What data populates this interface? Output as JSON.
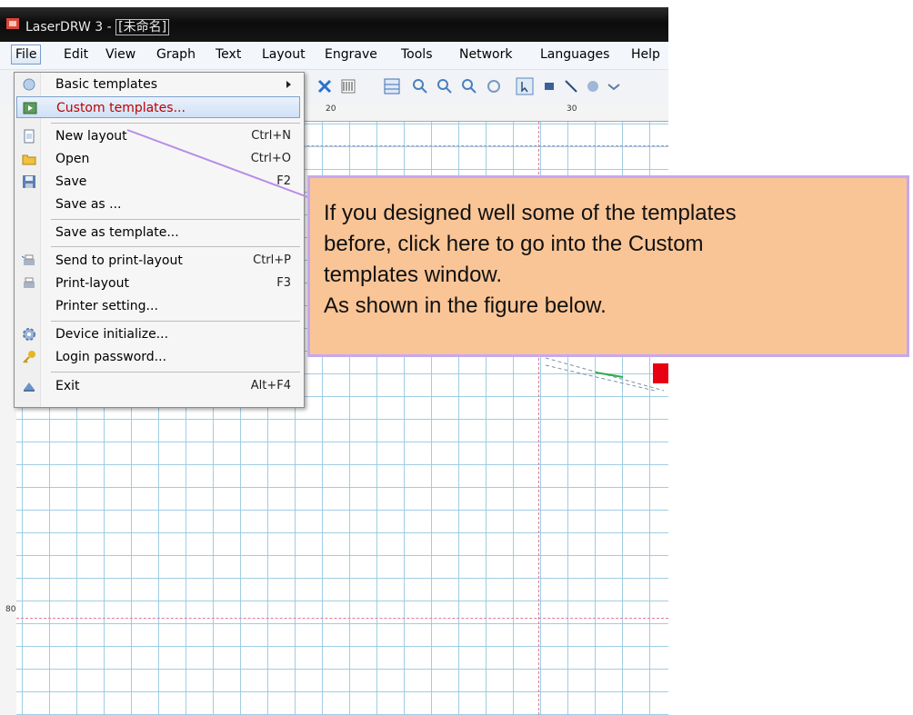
{
  "window": {
    "app_title": "LaserDRW 3 - ",
    "doc_tag": "[未命名]"
  },
  "menubar": [
    "File",
    "Edit",
    "View",
    "Graph",
    "Text",
    "Layout",
    "Engrave",
    "Tools",
    "Network",
    "Languages",
    "Help"
  ],
  "ruler": {
    "marks": [
      "20",
      "30"
    ],
    "side_mark": "80"
  },
  "file_menu": {
    "items": [
      {
        "label": "Basic templates",
        "shortcut": "",
        "icon": "templates-icon",
        "submenu": true
      },
      {
        "label": "Custom templates...",
        "shortcut": "",
        "icon": "custom-templates-icon",
        "selected": true
      },
      {
        "label": "New layout",
        "shortcut": "Ctrl+N",
        "icon": "new-layout-icon"
      },
      {
        "label": "Open",
        "shortcut": "Ctrl+O",
        "icon": "open-folder-icon"
      },
      {
        "label": "Save",
        "shortcut": "F2",
        "icon": "save-disk-icon"
      },
      {
        "label": "Save as ...",
        "shortcut": "",
        "icon": ""
      },
      {
        "label": "Save as template...",
        "shortcut": "",
        "icon": ""
      },
      {
        "label": "Send to print-layout",
        "shortcut": "Ctrl+P",
        "icon": "send-print-icon"
      },
      {
        "label": "Print-layout",
        "shortcut": "F3",
        "icon": "printer-icon"
      },
      {
        "label": "Printer setting...",
        "shortcut": "",
        "icon": ""
      },
      {
        "label": "Device initialize...",
        "shortcut": "",
        "icon": "gear-icon"
      },
      {
        "label": "Login password...",
        "shortcut": "",
        "icon": "key-icon"
      },
      {
        "label": "Exit",
        "shortcut": "Alt+F4",
        "icon": "exit-icon"
      }
    ]
  },
  "callout": {
    "line1": "If you designed well some of the templates",
    "line2": "before, click here to go into the Custom",
    "line3": "templates window.",
    "line4": "As shown in the figure below."
  },
  "colors": {
    "callout_bg": "#fac596",
    "callout_border": "#c6a7f2",
    "selected_text": "#c00000",
    "shape_red": "#e80012"
  }
}
